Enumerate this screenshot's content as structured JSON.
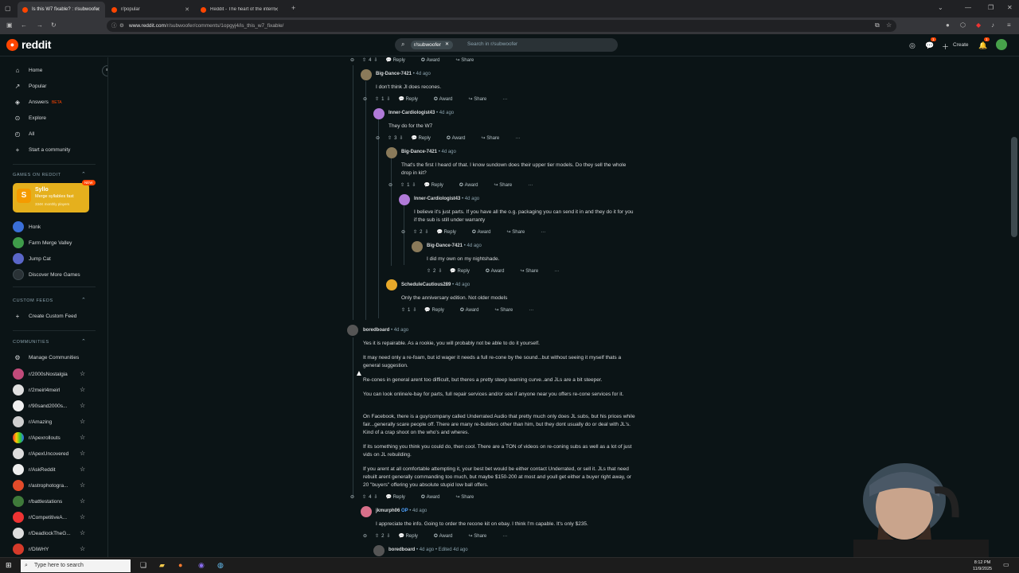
{
  "browser": {
    "tabs": [
      {
        "title": "Is this W7 fixable? : r/subwoofer",
        "active": true
      },
      {
        "title": "r/popular",
        "active": false
      },
      {
        "title": "Reddit - The heart of the intern",
        "active": false
      }
    ],
    "url_domain": "www.reddit.com",
    "url_path": "/r/subwoofer/comments/1opgyj4/is_this_w7_fixable/"
  },
  "header": {
    "logo_text": "reddit",
    "search_chip": "r/subwoofer",
    "search_placeholder": "Search in r/subwoofer",
    "create_label": "Create",
    "chat_badge": "1",
    "notif_badge": "1"
  },
  "sidebar": {
    "nav": [
      {
        "label": "Home",
        "icon": "home-icon"
      },
      {
        "label": "Popular",
        "icon": "popular-icon"
      },
      {
        "label": "Answers",
        "icon": "answers-icon",
        "badge": "BETA"
      },
      {
        "label": "Explore",
        "icon": "explore-icon"
      },
      {
        "label": "All",
        "icon": "all-icon"
      },
      {
        "label": "Start a community",
        "icon": "plus-icon"
      }
    ],
    "games_heading": "GAMES ON REDDIT",
    "featured_game": {
      "title": "Syllo",
      "subtitle": "Merge syllables fast",
      "players": "334K monthly players",
      "badge": "NEW"
    },
    "games": [
      "Honk",
      "Farm Merge Valley",
      "Jump Cat",
      "Discover More Games"
    ],
    "custom_heading": "CUSTOM FEEDS",
    "create_feed": "Create Custom Feed",
    "communities_heading": "COMMUNITIES",
    "manage": "Manage Communities",
    "communities": [
      "r/2000sNostalgia",
      "r/2meirl4meirl",
      "r/90sand2000s...",
      "r/Amazing",
      "r/Apexrollouts",
      "r/ApexUncovered",
      "r/AskReddit",
      "r/astrophotogra...",
      "r/battlestations",
      "r/CompetitiveA...",
      "r/DeadlockTheG...",
      "r/DiWHY"
    ]
  },
  "actions": {
    "reply": "Reply",
    "award": "Award",
    "share": "Share",
    "more": "···"
  },
  "comments": [
    {
      "id": "top",
      "votes": "4"
    },
    {
      "author": "Big-Dance-7421",
      "time": "4d ago",
      "text": "I don't think Jl does recones.",
      "votes": "1"
    },
    {
      "author": "Inner-Cardiologist43",
      "time": "4d ago",
      "text": "They do for the W7",
      "votes": "3"
    },
    {
      "author": "Big-Dance-7421",
      "time": "4d ago",
      "text": "That's the first I heard of that. I know sundown does their upper tier models. Do they sell the whole drop in kit?",
      "votes": "1"
    },
    {
      "author": "Inner-Cardiologist43",
      "time": "4d ago",
      "text": "I believe it's just parts. If you have all the o.g. packaging you can send it in and they do it for you if the sub is still under warranty",
      "votes": "2"
    },
    {
      "author": "Big-Dance-7421",
      "time": "4d ago",
      "text": "I did my own on my nightshade.",
      "votes": "2"
    },
    {
      "author": "ScheduleCautious289",
      "time": "4d ago",
      "text": "Only the anniversary edition. Not older models",
      "votes": "1"
    },
    {
      "author": "boredboard",
      "time": "4d ago",
      "votes": "4",
      "paragraphs": [
        "Yes it is repairable. As a rookie, you will probably not be able to do it yourself.",
        "It may need only a re-foam, but id wager it needs a full re-cone by the sound...but without seeing it myself thats a general suggestion.",
        "Re-cones in general arent too difficult, but theres a pretty steep learning curve..and JLs are a bit steeper.",
        "You can look online/e-bay for parts, full repair services and/or see if anyone near you offers re-cone services for it.",
        "On Facebook, there is a guy/company called Underrated Audio that pretty much only does JL subs, but his prices while fair...generally scare people off. There are many re-builders other than him, but they dont usually do or deal with JL's. Kind of a crap shoot on the who's and wheres.",
        "If its something you think you could do, then cool. There are a TON of videos on re-coning subs as well as a lot of just vids on JL rebuilding.",
        "If you arent at all comfortable attempting it, your best bet would be either contact Underrated, or sell it. JLs that need rebuilt arent generally commanding too much, but maybe $150-200 at most and youll get either a buyer right away, or 20 \"buyers\" offering you absolute stupid low ball offers."
      ]
    },
    {
      "author": "jkmurph06",
      "op": "OP",
      "time": "4d ago",
      "text": "I appreciate the info. Going to order the recone kit on ebay. I think I'm capable. It's only $235.",
      "votes": "2"
    },
    {
      "author": "boredboard",
      "time": "4d ago",
      "edited": "Edited 4d ago"
    }
  ],
  "taskbar": {
    "search_placeholder": "Type here to search",
    "time": "8:12 PM",
    "date": "11/9/2025"
  }
}
